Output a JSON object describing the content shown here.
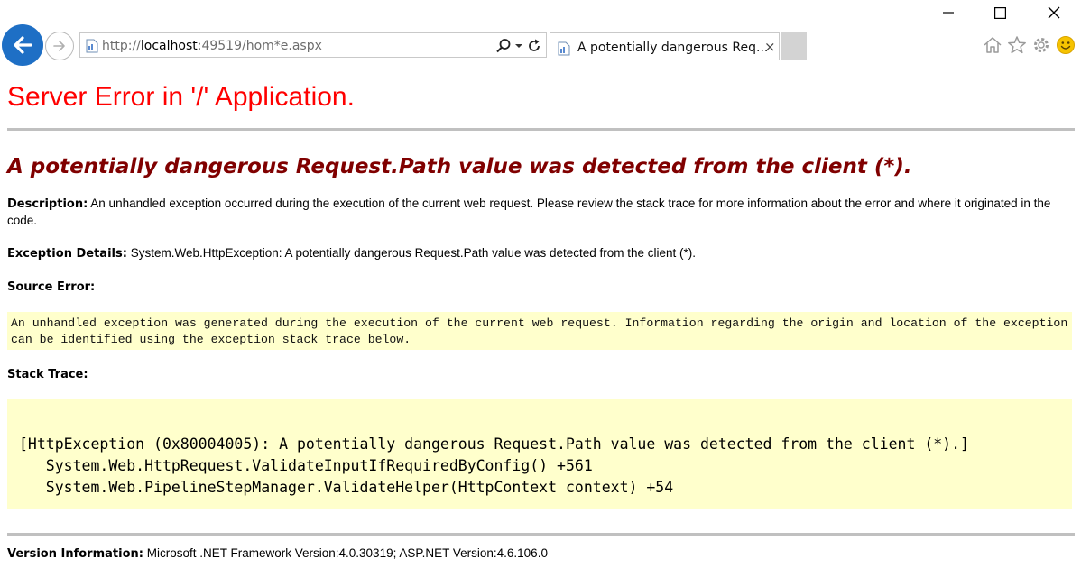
{
  "browser": {
    "address_prefix": "http://",
    "address_host": "localhost",
    "address_rest": ":49519/hom*e.aspx",
    "tab_title": "A potentially dangerous Req...",
    "tab_close": "×",
    "icons": [
      "back-arrow-icon",
      "forward-arrow-icon",
      "page-icon",
      "search-icon",
      "dropdown-icon",
      "refresh-icon",
      "home-icon",
      "favorites-star-icon",
      "settings-gear-icon",
      "smiley-feedback-icon",
      "minimize-icon",
      "maximize-icon",
      "close-icon"
    ]
  },
  "page": {
    "title": "Server Error in '/' Application.",
    "subtitle": "A potentially dangerous Request.Path value was detected from the client (*).",
    "description_label": "Description:",
    "description_text": "An unhandled exception occurred during the execution of the current web request. Please review the stack trace for more information about the error and where it originated in the code.",
    "exception_label": "Exception Details:",
    "exception_text": "System.Web.HttpException: A potentially dangerous Request.Path value was detected from the client (*).",
    "source_label": "Source Error:",
    "source_text": "An unhandled exception was generated during the execution of the current web request. Information regarding the origin and location of the exception can be identified using the exception stack trace below.",
    "stack_label": "Stack Trace:",
    "stack_lines": [
      "[HttpException (0x80004005): A potentially dangerous Request.Path value was detected from the client (*).]",
      "   System.Web.HttpRequest.ValidateInputIfRequiredByConfig() +561",
      "   System.Web.PipelineStepManager.ValidateHelper(HttpContext context) +54"
    ],
    "version_label": "Version Information:",
    "version_text": "Microsoft .NET Framework Version:4.0.30319; ASP.NET Version:4.6.106.0"
  },
  "colors": {
    "title": "#ff0000",
    "subtitle": "#800000",
    "code_background": "#ffffcc",
    "rule": "#c0c0c0",
    "back_button": "#1e6fc5"
  }
}
